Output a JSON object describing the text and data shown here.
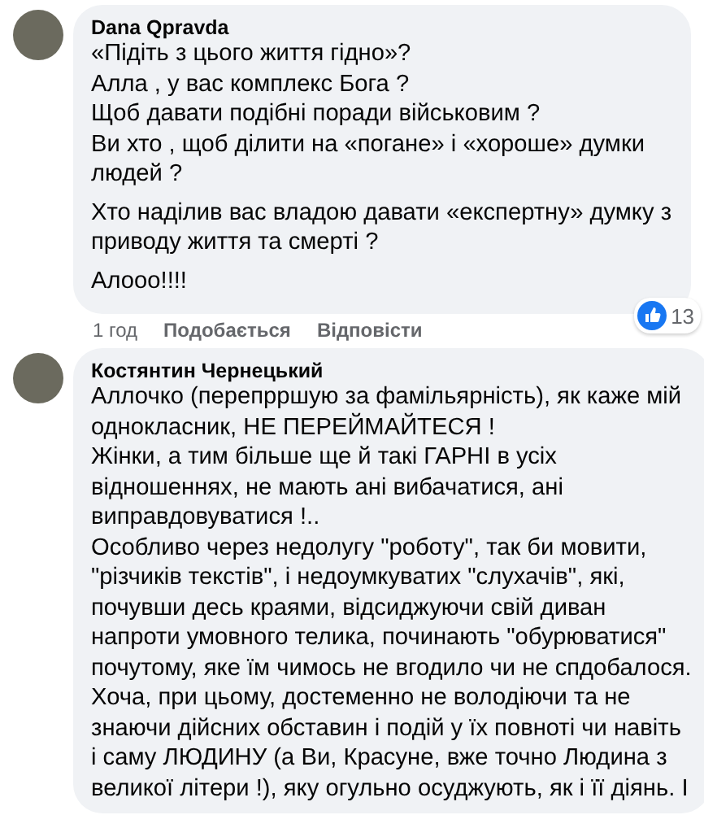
{
  "comments": [
    {
      "author": "Dana Qpravda",
      "paragraphs": [
        [
          "«Підіть з цього життя гідно»?",
          "Алла , у вас комплекс Бога ?",
          "Щоб давати подібні поради військовим ?",
          "Ви хто , щоб ділити на «погане» і «хороше» думки",
          "людей ?"
        ],
        [
          "Хто наділив вас владою давати «експертну» думку з",
          "приводу життя та смерті ?"
        ],
        [
          "Алооо!!!!"
        ]
      ],
      "reaction_count": "13",
      "time": "1 год",
      "actions": [
        "Подобається",
        "Відповісти"
      ]
    },
    {
      "author": "Костянтин Чернецький",
      "paragraphs": [
        [
          "Аллочко (перепрршую за фамільярність), як каже мій",
          "однокласник, НЕ ПЕРЕЙМАЙТЕСЯ !",
          "Жінки, а тим більше ще й такі ГАРНІ в усіх",
          "відношеннях, не мають ані вибачатися, ані",
          "виправдовуватися !..",
          "Особливо через недолугу \"роботу\", так би мовити,",
          "\"різчиків текстів\", і недоумкуватих \"слухачів\", які,",
          "почувши десь краями, відсиджуючи свій диван",
          "напроти умовного телика, починають \"обурюватися\"",
          "почутому, яке їм чимось не вгодило чи не спдобалося.",
          "Хоча, при цьому, достеменно не володіючи та не",
          "знаючи дійсних обставин і подій у їх повноті чи навіть",
          "і саму ЛЮДИНУ (а Ви, Красуне, вже точно Людина з",
          "великої літери !), яку огульно осуджують, як і її діянь. І"
        ]
      ]
    }
  ]
}
